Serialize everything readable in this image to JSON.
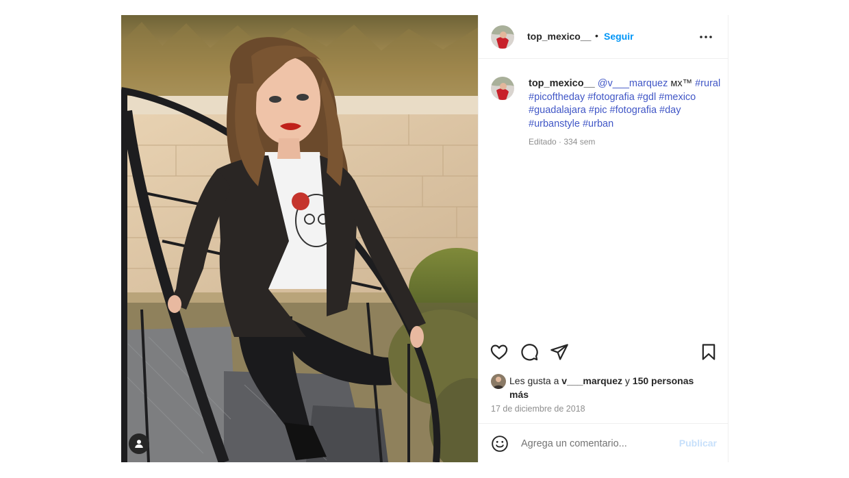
{
  "post": {
    "author": "top_mexico__",
    "dot": "•",
    "follow_label": "Seguir",
    "caption": {
      "user": "top_mexico__",
      "mention": "@v___marquez",
      "mx": "ᴍx™",
      "tags_line1": "#rural",
      "tags_line2": "#picoftheday #fotografia #gdl #mexico",
      "tags_line3": "#guadalajara #pic #fotografia #day",
      "tags_line4": "#urbanstyle #urban"
    },
    "meta": "Editado · 334 sem",
    "likes": {
      "prefix": "Les gusta a",
      "user": "v___marquez",
      "joiner": "y",
      "others": "150 personas más"
    },
    "date": "17 de diciembre de 2018",
    "comment": {
      "placeholder": "Agrega un comentario...",
      "publish_label": "Publicar"
    }
  },
  "colors": {
    "link": "#4056c6",
    "follow": "#0095f6",
    "publish_disabled": "#c7e0fb",
    "meta": "#8e8e8e"
  },
  "icons": [
    "user-tag-icon",
    "more-options-icon",
    "heart-icon",
    "comment-icon",
    "share-icon",
    "bookmark-icon",
    "emoji-icon"
  ]
}
